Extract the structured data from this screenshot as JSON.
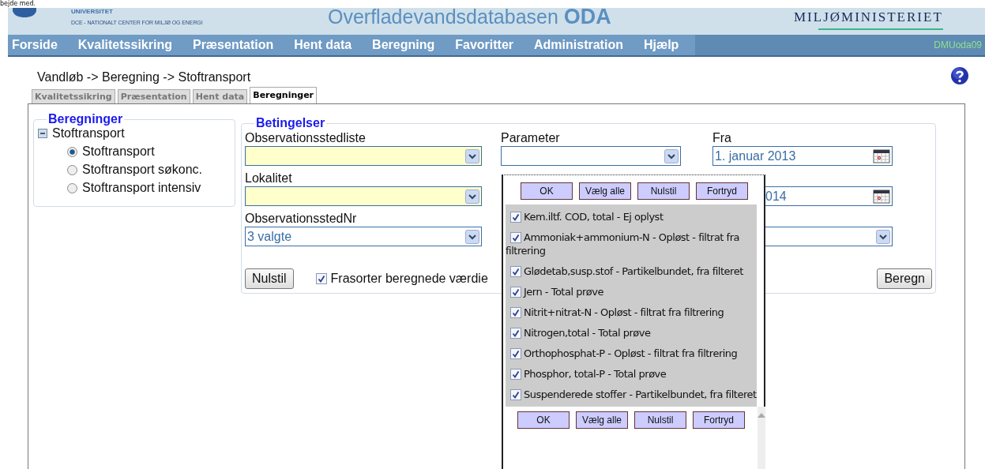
{
  "top_text": "bejde med.",
  "header": {
    "org_line1": "UNIVERSITET",
    "org_line2": "DCE - NATIONALT CENTER FOR MILJØ OG ENERGI",
    "title": "Overfladevandsdatabasen",
    "title_bold": "ODA",
    "ministry": "MILJØMINISTERIET"
  },
  "nav": {
    "items": [
      "Forside",
      "Kvalitetssikring",
      "Præsentation",
      "Hent data",
      "Beregning",
      "Favoritter",
      "Administration",
      "Hjælp"
    ],
    "user": "DMUoda09"
  },
  "breadcrumb": "Vandløb -> Beregning -> Stoftransport",
  "tabs": [
    {
      "label": "Kvalitetssikring",
      "selected": false
    },
    {
      "label": "Præsentation",
      "selected": false
    },
    {
      "label": "Hent data",
      "selected": false
    },
    {
      "label": "Beregninger",
      "selected": true
    }
  ],
  "calculations": {
    "legend": "Beregninger",
    "tree": [
      {
        "label": "Stoftransport",
        "expanded": true,
        "children": [
          {
            "label": "Stoftransport",
            "selected": true
          },
          {
            "label": "Stoftransport søkonc.",
            "selected": false
          },
          {
            "label": "Stoftransport intensiv",
            "selected": false
          }
        ]
      }
    ]
  },
  "conditions": {
    "legend": "Betingelser",
    "columns": [
      [
        {
          "label": "Observationsstedliste",
          "kind": "select",
          "highlighted": true
        },
        {
          "label": "Lokalitet",
          "kind": "select",
          "highlighted": true
        },
        {
          "label": "ObservationsstedNr",
          "kind": "select",
          "value": "3 valgte",
          "highlighted": false
        }
      ],
      [
        {
          "label": "Parameter",
          "kind": "select",
          "highlighted": false
        }
      ],
      [
        {
          "label": "Fra",
          "kind": "date",
          "value": "1. januar 2013",
          "highlighted": false
        },
        {
          "kind": "date",
          "value": "014",
          "highlighted": false
        },
        {
          "kind": "select",
          "highlighted": false
        }
      ]
    ],
    "reset_button": "Nulstil",
    "filter_checkbox": {
      "label": "Frasorter beregnede værdie",
      "checked": true
    },
    "compute_button": "Beregn"
  },
  "parameter_dropdown": {
    "buttons": [
      "OK",
      "Vælg alle",
      "Nulstil",
      "Fortryd"
    ],
    "items": [
      {
        "label": "Kem.iltf. COD, total - Ej oplyst",
        "checked": true
      },
      {
        "label": "Ammoniak+ammonium-N - Opløst - filtrat fra filtrering",
        "checked": true
      },
      {
        "label": "Glødetab,susp.stof - Partikelbundet, fra filteret",
        "checked": true
      },
      {
        "label": "Jern - Total prøve",
        "checked": true
      },
      {
        "label": "Nitrit+nitrat-N - Opløst - filtrat fra filtrering",
        "checked": true
      },
      {
        "label": "Nitrogen,total - Total prøve",
        "checked": true
      },
      {
        "label": "Orthophosphat-P - Opløst - filtrat fra filtrering",
        "checked": true
      },
      {
        "label": "Phosphor, total-P - Total prøve",
        "checked": true
      },
      {
        "label": "Suspenderede stoffer - Partikelbundet, fra filteret",
        "checked": true
      }
    ],
    "bottom_buttons": [
      "OK",
      "Vælg alle",
      "Nulstil",
      "Fortryd"
    ]
  }
}
